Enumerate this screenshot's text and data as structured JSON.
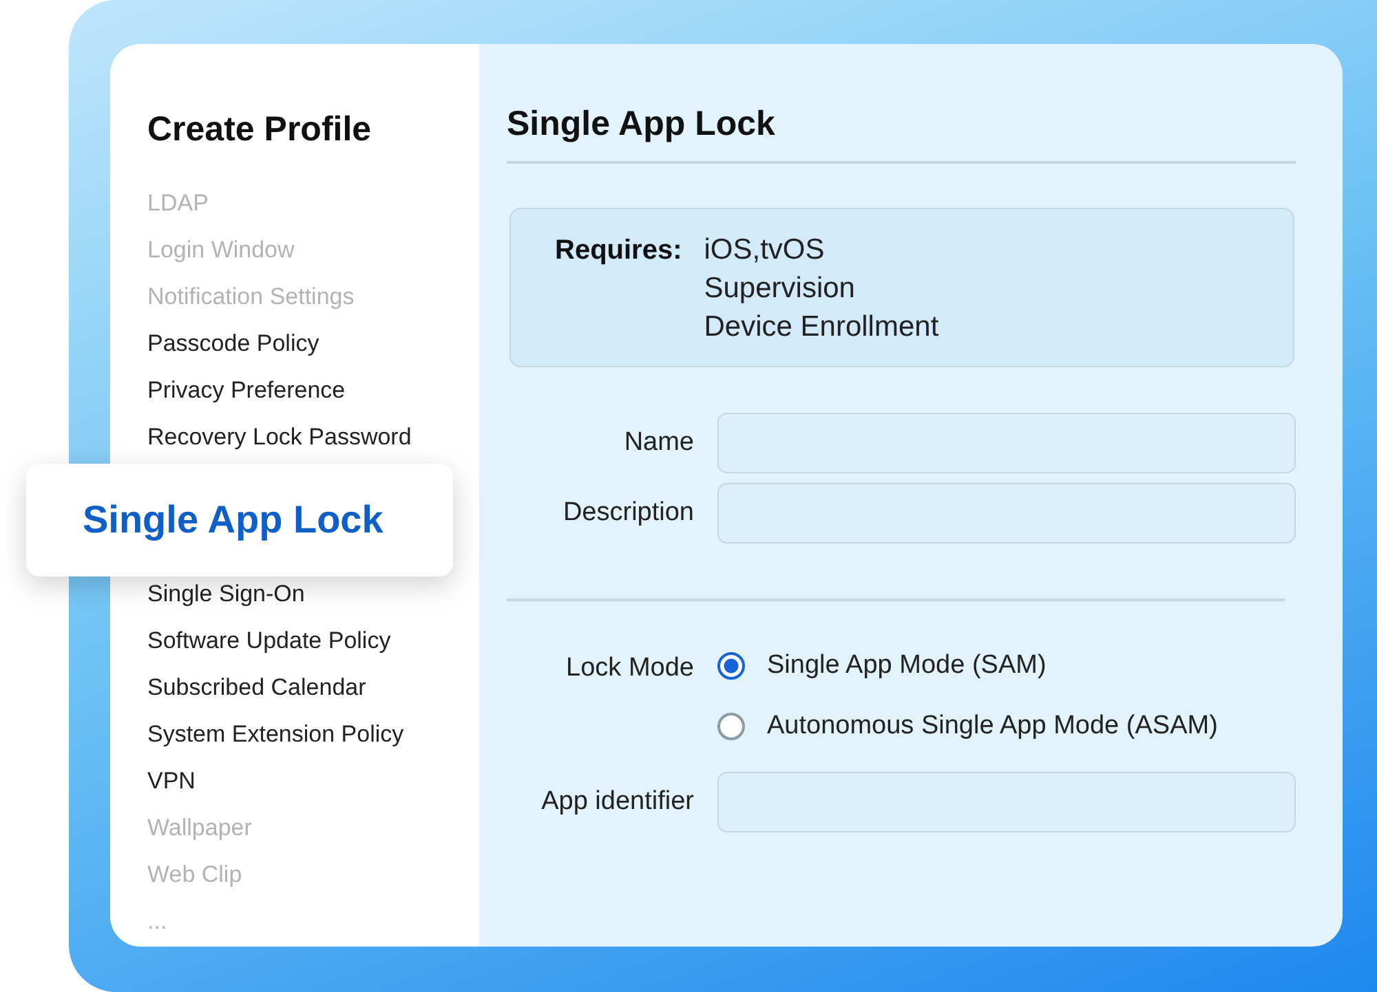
{
  "sidebar": {
    "title": "Create Profile",
    "items": [
      {
        "label": "LDAP",
        "dimmed": true,
        "selected": false
      },
      {
        "label": "Login Window",
        "dimmed": true,
        "selected": false
      },
      {
        "label": "Notification Settings",
        "dimmed": true,
        "selected": false
      },
      {
        "label": "Passcode Policy",
        "dimmed": false,
        "selected": false
      },
      {
        "label": "Privacy Preference",
        "dimmed": false,
        "selected": false
      },
      {
        "label": "Recovery Lock Password",
        "dimmed": false,
        "selected": false
      },
      {
        "label": "Single App Lock",
        "dimmed": false,
        "selected": true
      },
      {
        "label": "Single Sign-On",
        "dimmed": false,
        "selected": false
      },
      {
        "label": "Software Update Policy",
        "dimmed": false,
        "selected": false
      },
      {
        "label": "Subscribed Calendar",
        "dimmed": false,
        "selected": false
      },
      {
        "label": "System Extension Policy",
        "dimmed": false,
        "selected": false
      },
      {
        "label": "VPN",
        "dimmed": false,
        "selected": false
      },
      {
        "label": "Wallpaper",
        "dimmed": true,
        "selected": false
      },
      {
        "label": "Web Clip",
        "dimmed": true,
        "selected": false
      },
      {
        "label": "...",
        "dimmed": true,
        "selected": false
      }
    ]
  },
  "main": {
    "title": "Single App Lock",
    "requires": {
      "label": "Requires:",
      "values": [
        "iOS,tvOS",
        "Supervision",
        "Device Enrollment"
      ]
    },
    "fields": [
      {
        "label": "Name"
      },
      {
        "label": "Description"
      }
    ],
    "lock_mode": {
      "label": "Lock Mode",
      "options": [
        {
          "label": "Single App Mode (SAM)",
          "selected": true
        },
        {
          "label": "Autonomous Single App Mode (ASAM)",
          "selected": false
        }
      ]
    },
    "app_field": {
      "label": "App identifier"
    }
  }
}
